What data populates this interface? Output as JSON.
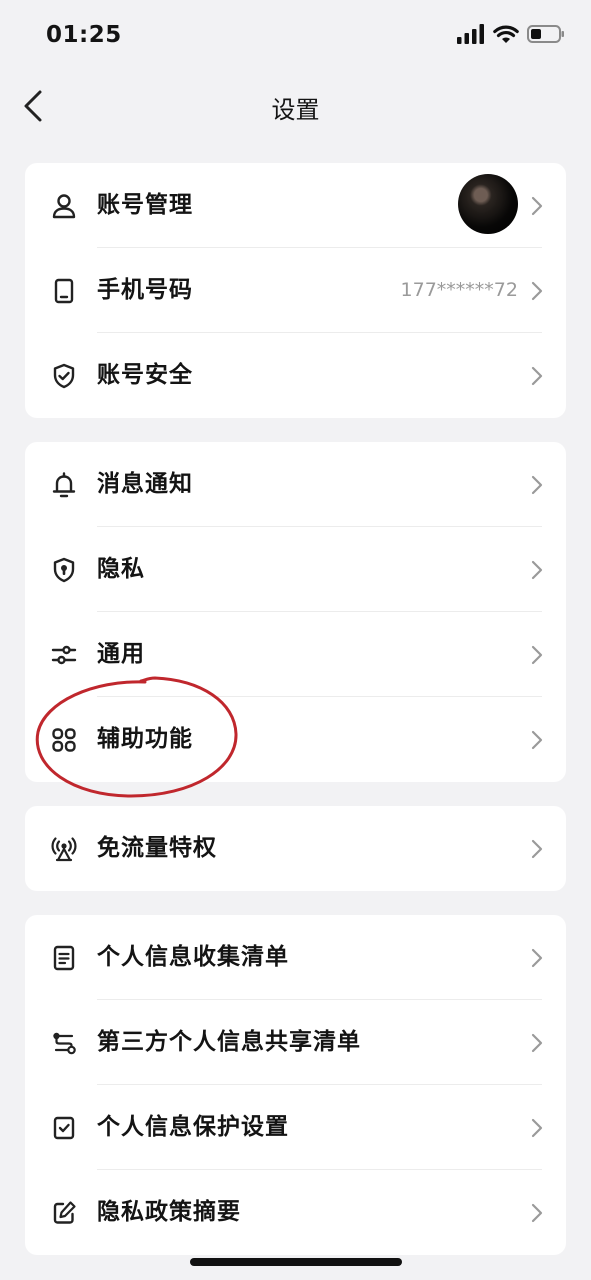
{
  "status_bar": {
    "time": "01:25",
    "signal_icon": "signal-bars-icon",
    "wifi_icon": "wifi-icon",
    "battery_icon": "battery-low-icon"
  },
  "nav": {
    "title": "设置",
    "back_icon": "chevron-left-icon"
  },
  "groups": [
    {
      "items": [
        {
          "label": "账号管理",
          "icon": "person-icon",
          "trailing": "avatar"
        },
        {
          "label": "手机号码",
          "icon": "phone-icon",
          "value": "177******72"
        },
        {
          "label": "账号安全",
          "icon": "shield-check-icon"
        }
      ]
    },
    {
      "items": [
        {
          "label": "消息通知",
          "icon": "bell-icon"
        },
        {
          "label": "隐私",
          "icon": "shield-lock-icon"
        },
        {
          "label": "通用",
          "icon": "sliders-icon"
        },
        {
          "label": "辅助功能",
          "icon": "grid-icon"
        }
      ]
    },
    {
      "items": [
        {
          "label": "免流量特权",
          "icon": "broadcast-icon"
        }
      ]
    },
    {
      "items": [
        {
          "label": "个人信息收集清单",
          "icon": "document-icon"
        },
        {
          "label": "第三方个人信息共享清单",
          "icon": "share-nodes-icon"
        },
        {
          "label": "个人信息保护设置",
          "icon": "checkbox-icon"
        },
        {
          "label": "隐私政策摘要",
          "icon": "edit-icon"
        }
      ]
    }
  ],
  "colors": {
    "background": "#f2f2f4",
    "card": "#ffffff",
    "text": "#141414",
    "secondary_text": "#9a9a9a",
    "annotation": "#c0272d"
  }
}
